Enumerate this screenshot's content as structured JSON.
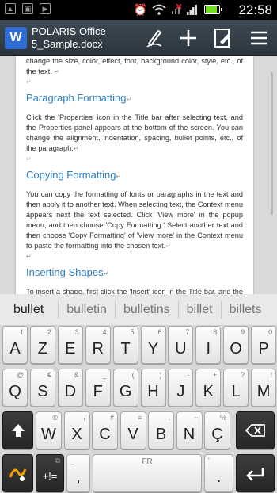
{
  "status_bar": {
    "time": "22:58",
    "battery_level": 0.85,
    "left_icons": [
      "image-icon",
      "gallery-icon",
      "play-store-icon"
    ],
    "right_icons": [
      "alarm-icon",
      "wifi-icon",
      "no-signal-icon",
      "signal-icon",
      "battery-icon"
    ]
  },
  "app_bar": {
    "app_name": "POLARIS Office",
    "file_name": "5_Sample.docx",
    "doc_icon_label": "W",
    "actions": [
      "pen-icon",
      "add-icon",
      "edit-document-icon",
      "menu-icon"
    ]
  },
  "document": {
    "intro_text": "change the size, color, effect, font, background color, style, etc., of the text.",
    "sections": [
      {
        "heading": "Paragraph Formatting",
        "body": "Click the 'Properties' icon in the Title bar after selecting text, and the Properties panel appears at the bottom of the screen. You can change the alignment, indentation, spacing, bullet points, etc., of the paragraph."
      },
      {
        "heading": "Copying Formatting",
        "body": "You can copy the formatting of fonts or paragraphs in the text and then apply it to another text. When selecting text, the Context menu appears next the text selected. Click 'View more' in the popup menu, and then choose 'Copy Formatting.' Select another text and then choose 'Copy Formatting' of 'View more' in the Context menu to paste the formatting into the chosen text."
      },
      {
        "heading": "Inserting Shapes",
        "body": "To insert a shape, first click the 'Insert' icon in the Title bar, and the Object items you can insert will appear. Choose 'Shapes' from the"
      }
    ],
    "paragraph_mark": "↵"
  },
  "suggestions": [
    "bullet",
    "bulletin",
    "bulletins",
    "billet",
    "billets"
  ],
  "keyboard": {
    "row1": [
      {
        "main": "A",
        "sub": "1"
      },
      {
        "main": "Z",
        "sub": "2"
      },
      {
        "main": "E",
        "sub": "3"
      },
      {
        "main": "R",
        "sub": "4"
      },
      {
        "main": "T",
        "sub": "5"
      },
      {
        "main": "Y",
        "sub": "6"
      },
      {
        "main": "U",
        "sub": "7"
      },
      {
        "main": "I",
        "sub": "8"
      },
      {
        "main": "O",
        "sub": "9"
      },
      {
        "main": "P",
        "sub": "0"
      }
    ],
    "row2": [
      {
        "main": "Q",
        "sub": "@"
      },
      {
        "main": "S",
        "sub": "€"
      },
      {
        "main": "D",
        "sub": "&"
      },
      {
        "main": "F",
        "sub": "_"
      },
      {
        "main": "G",
        "sub": "("
      },
      {
        "main": "H",
        "sub": ")"
      },
      {
        "main": "J",
        "sub": "-"
      },
      {
        "main": "K",
        "sub": "+"
      },
      {
        "main": "L",
        "sub": "?"
      },
      {
        "main": "M",
        "sub": "!"
      }
    ],
    "row3": [
      {
        "main": "W",
        "sub": "©"
      },
      {
        "main": "X",
        "sub": "/"
      },
      {
        "main": "C",
        "sub": "#"
      },
      {
        "main": "V",
        "sub": "="
      },
      {
        "main": "B",
        "sub": "."
      },
      {
        "main": "N",
        "sub": "~"
      },
      {
        "main": "Ç",
        "sub": "%"
      }
    ],
    "row4": {
      "symbols_label": "+!=",
      "comma": ",",
      "comma_sub": "_",
      "space_label": "FR",
      "period": ".",
      "period_sub": "'"
    }
  },
  "colors": {
    "heading": "#2f7fbf",
    "toolbar": "#36424c",
    "battery": "#6fe01e"
  }
}
